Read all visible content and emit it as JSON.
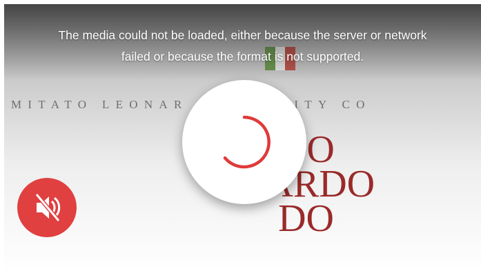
{
  "player": {
    "error_line_1": "The media could not be loaded, either because the server or network",
    "error_line_2": "failed or because the format is not supported.",
    "loading_icon": "spinner-icon",
    "mute_button_icon": "speaker-muted-icon"
  },
  "poster": {
    "brand_line": "MITATO LEONAR   AN QUALITY CO",
    "logo_row_1": "O",
    "logo_row_2": "NARDO",
    "logo_row_3": "DO"
  },
  "colors": {
    "accent": "#e04040",
    "spinner": "#e03a3a",
    "logo": "#9a2a2a"
  }
}
